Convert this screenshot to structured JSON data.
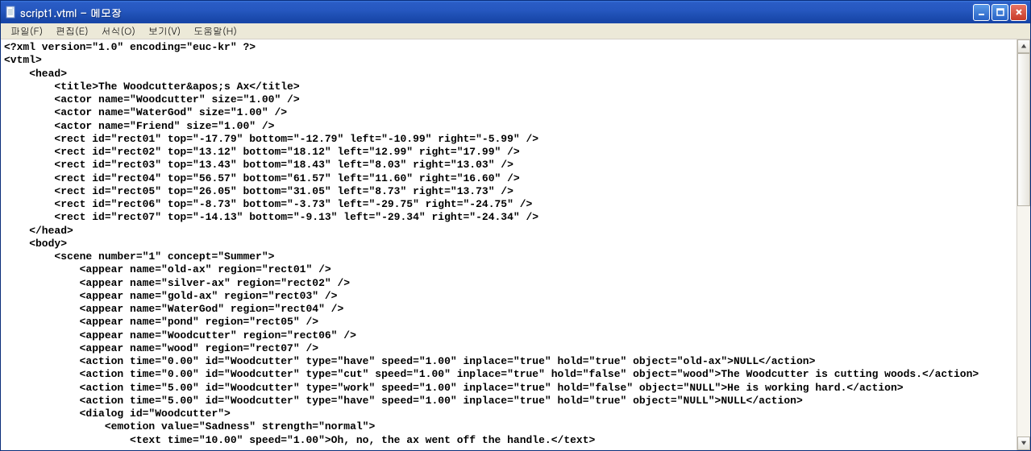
{
  "window": {
    "title": "script1.vtml - 메모장"
  },
  "menubar": {
    "file": "파일(F)",
    "edit": "편집(E)",
    "format": "서식(O)",
    "view": "보기(V)",
    "help": "도움말(H)"
  },
  "content": "<?xml version=\"1.0\" encoding=\"euc-kr\" ?>\n<vtml>\n    <head>\n        <title>The Woodcutter&apos;s Ax</title>\n        <actor name=\"Woodcutter\" size=\"1.00\" />\n        <actor name=\"WaterGod\" size=\"1.00\" />\n        <actor name=\"Friend\" size=\"1.00\" />\n        <rect id=\"rect01\" top=\"-17.79\" bottom=\"-12.79\" left=\"-10.99\" right=\"-5.99\" />\n        <rect id=\"rect02\" top=\"13.12\" bottom=\"18.12\" left=\"12.99\" right=\"17.99\" />\n        <rect id=\"rect03\" top=\"13.43\" bottom=\"18.43\" left=\"8.03\" right=\"13.03\" />\n        <rect id=\"rect04\" top=\"56.57\" bottom=\"61.57\" left=\"11.60\" right=\"16.60\" />\n        <rect id=\"rect05\" top=\"26.05\" bottom=\"31.05\" left=\"8.73\" right=\"13.73\" />\n        <rect id=\"rect06\" top=\"-8.73\" bottom=\"-3.73\" left=\"-29.75\" right=\"-24.75\" />\n        <rect id=\"rect07\" top=\"-14.13\" bottom=\"-9.13\" left=\"-29.34\" right=\"-24.34\" />\n    </head>\n    <body>\n        <scene number=\"1\" concept=\"Summer\">\n            <appear name=\"old-ax\" region=\"rect01\" />\n            <appear name=\"silver-ax\" region=\"rect02\" />\n            <appear name=\"gold-ax\" region=\"rect03\" />\n            <appear name=\"WaterGod\" region=\"rect04\" />\n            <appear name=\"pond\" region=\"rect05\" />\n            <appear name=\"Woodcutter\" region=\"rect06\" />\n            <appear name=\"wood\" region=\"rect07\" />\n            <action time=\"0.00\" id=\"Woodcutter\" type=\"have\" speed=\"1.00\" inplace=\"true\" hold=\"true\" object=\"old-ax\">NULL</action>\n            <action time=\"0.00\" id=\"Woodcutter\" type=\"cut\" speed=\"1.00\" inplace=\"true\" hold=\"false\" object=\"wood\">The Woodcutter is cutting woods.</action>\n            <action time=\"5.00\" id=\"Woodcutter\" type=\"work\" speed=\"1.00\" inplace=\"true\" hold=\"false\" object=\"NULL\">He is working hard.</action>\n            <action time=\"5.00\" id=\"Woodcutter\" type=\"have\" speed=\"1.00\" inplace=\"true\" hold=\"true\" object=\"NULL\">NULL</action>\n            <dialog id=\"Woodcutter\">\n                <emotion value=\"Sadness\" strength=\"normal\">\n                    <text time=\"10.00\" speed=\"1.00\">Oh, no, the ax went off the handle.</text>"
}
